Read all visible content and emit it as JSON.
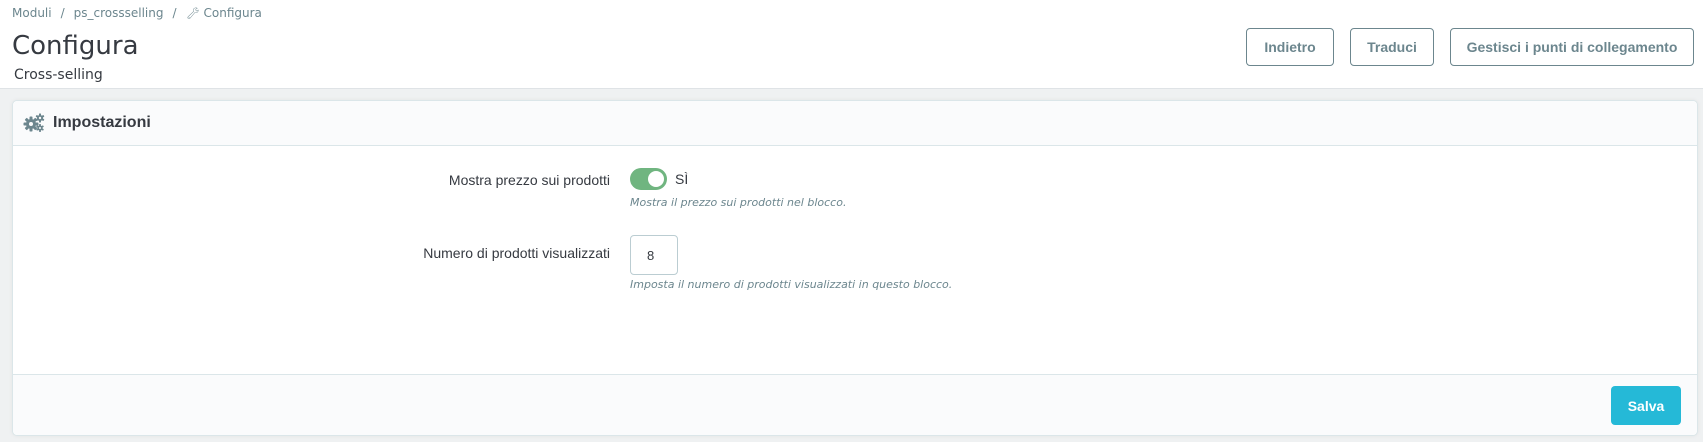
{
  "breadcrumb": {
    "items": [
      "Moduli",
      "ps_crossselling",
      "Configura"
    ],
    "separator": "/"
  },
  "header": {
    "title": "Configura",
    "subtitle": "Cross-selling",
    "buttons": {
      "back": "Indietro",
      "translate": "Traduci",
      "hooks": "Gestisci i punti di collegamento"
    }
  },
  "panel": {
    "title": "Impostazioni",
    "icon": "cogs-icon",
    "fields": {
      "show_price": {
        "label": "Mostra prezzo sui prodotti",
        "value_label": "SÌ",
        "enabled": true,
        "help": "Mostra il prezzo sui prodotti nel blocco."
      },
      "product_count": {
        "label": "Numero di prodotti visualizzati",
        "value": "8",
        "help": "Imposta il numero di prodotti visualizzati in questo blocco."
      }
    },
    "save_label": "Salva"
  },
  "colors": {
    "accent": "#25b9d7",
    "switch_on": "#70b580",
    "text": "#363a41",
    "muted": "#6c868e"
  }
}
